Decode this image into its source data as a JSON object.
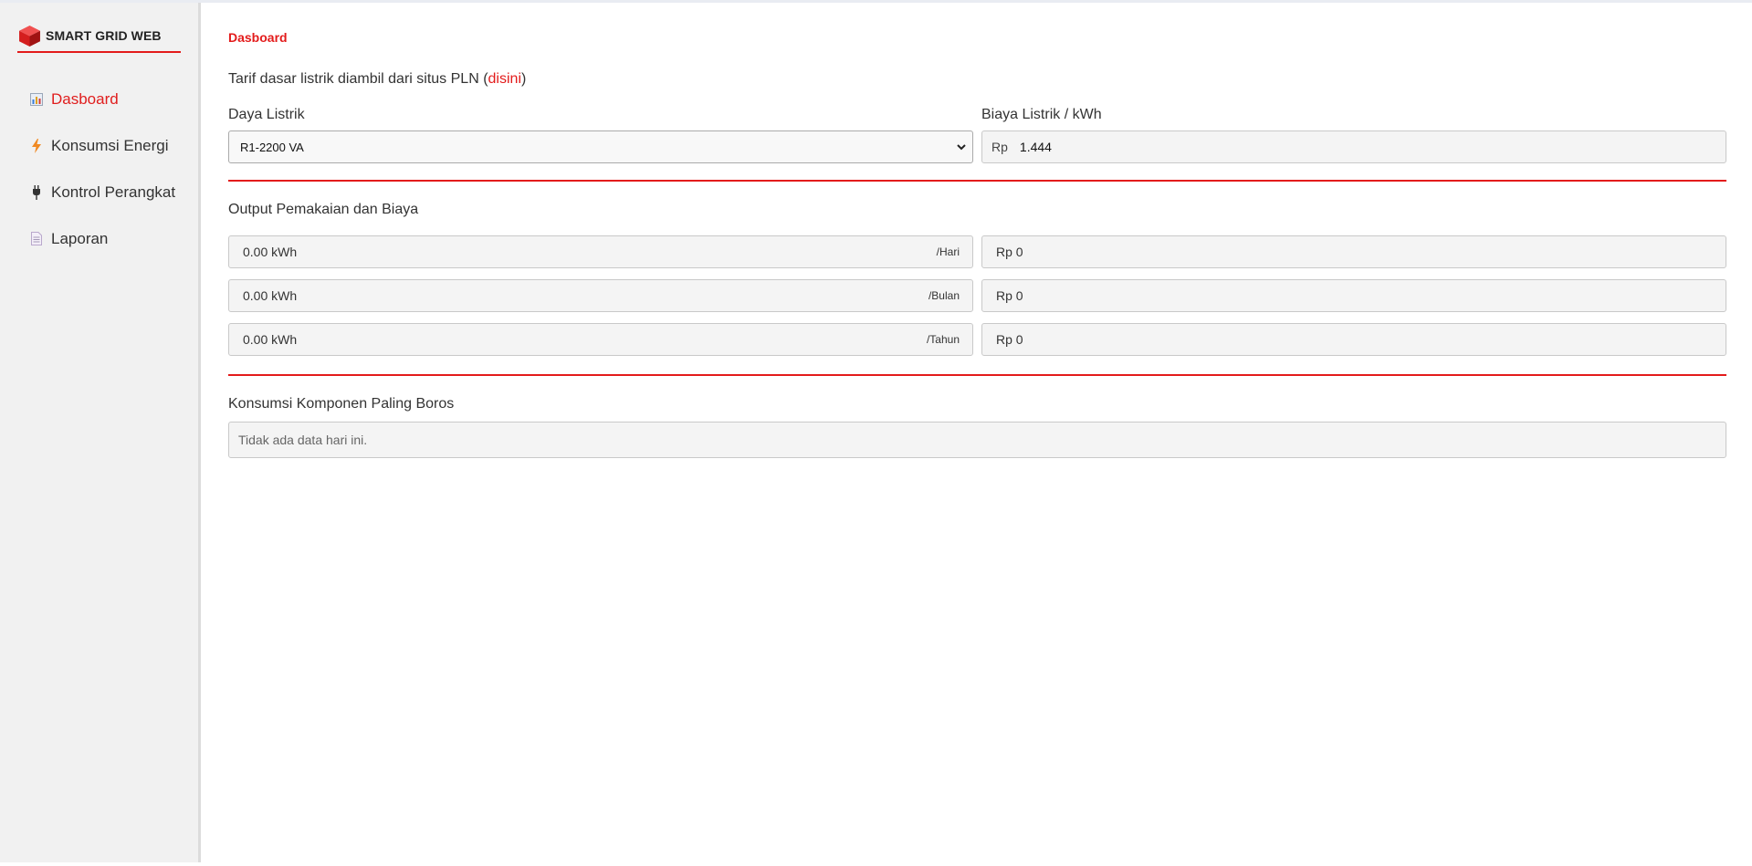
{
  "sidebar": {
    "brand": "SMART GRID WEB",
    "items": [
      {
        "label": "Dasboard",
        "icon": "bar-chart-icon",
        "active": true
      },
      {
        "label": "Konsumsi Energi",
        "icon": "lightning-icon",
        "active": false
      },
      {
        "label": "Kontrol Perangkat",
        "icon": "plug-icon",
        "active": false
      },
      {
        "label": "Laporan",
        "icon": "document-icon",
        "active": false
      }
    ]
  },
  "main": {
    "breadcrumb": "Dasboard",
    "tariff_text": "Tarif dasar listrik diambil dari situs PLN (",
    "tariff_link": "disini",
    "tariff_close": ")",
    "daya_label": "Daya Listrik",
    "daya_value": "R1-2200 VA",
    "biaya_label": "Biaya Listrik / kWh",
    "biaya_prefix": "Rp",
    "biaya_value": "1.444",
    "output_title": "Output Pemakaian dan Biaya",
    "outputs": [
      {
        "kwh": "0.00 kWh",
        "unit": "/Hari",
        "cost": "Rp 0"
      },
      {
        "kwh": "0.00 kWh",
        "unit": "/Bulan",
        "cost": "Rp 0"
      },
      {
        "kwh": "0.00 kWh",
        "unit": "/Tahun",
        "cost": "Rp 0"
      }
    ],
    "boros_title": "Konsumsi Komponen Paling Boros",
    "boros_empty": "Tidak ada data hari ini."
  },
  "colors": {
    "accent": "#e31b1b",
    "sidebar_bg": "#f1f1f1",
    "field_bg": "#f4f4f4"
  }
}
